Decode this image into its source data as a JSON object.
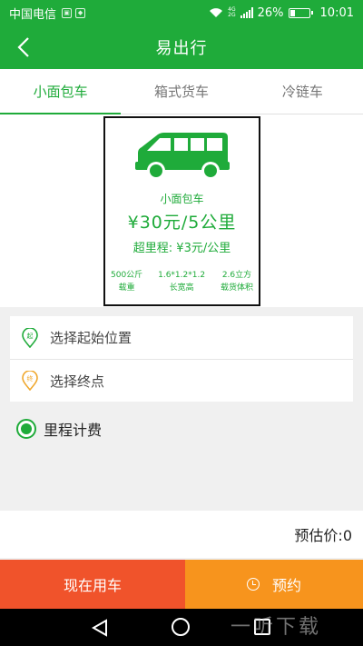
{
  "status_bar": {
    "carrier": "中国电信",
    "network_labels": [
      "4G",
      "2G"
    ],
    "battery_text": "26%",
    "battery_level": 0.26,
    "time": "10:01"
  },
  "app_bar": {
    "title": "易出行",
    "back_icon": "chevron-left-icon"
  },
  "tabs": [
    {
      "label": "小面包车",
      "active": true
    },
    {
      "label": "箱式货车",
      "active": false
    },
    {
      "label": "冷链车",
      "active": false
    }
  ],
  "vehicle_card": {
    "icon": "van-icon",
    "name": "小面包车",
    "price": "¥30元/5公里",
    "overage": "超里程: ¥3元/公里",
    "specs": [
      {
        "value": "500公斤",
        "label": "载重"
      },
      {
        "value": "1.6*1.2*1.2",
        "label": "长宽高"
      },
      {
        "value": "2.6立方",
        "label": "载货体积"
      }
    ]
  },
  "locations": {
    "start_placeholder": "选择起始位置",
    "end_placeholder": "选择终点",
    "start_pin_text": "起",
    "end_pin_text": "终"
  },
  "billing": {
    "option": "里程计费",
    "selected": true
  },
  "estimate": {
    "text": "预估价:0"
  },
  "actions": {
    "use_now": "现在用车",
    "reserve": "预约"
  },
  "watermark": "一听下载",
  "colors": {
    "primary": "#1fab3a",
    "use_now_bg": "#f0532b",
    "reserve_bg": "#f7941d",
    "start_pin": "#1fab3a",
    "end_pin": "#f0a72b"
  }
}
